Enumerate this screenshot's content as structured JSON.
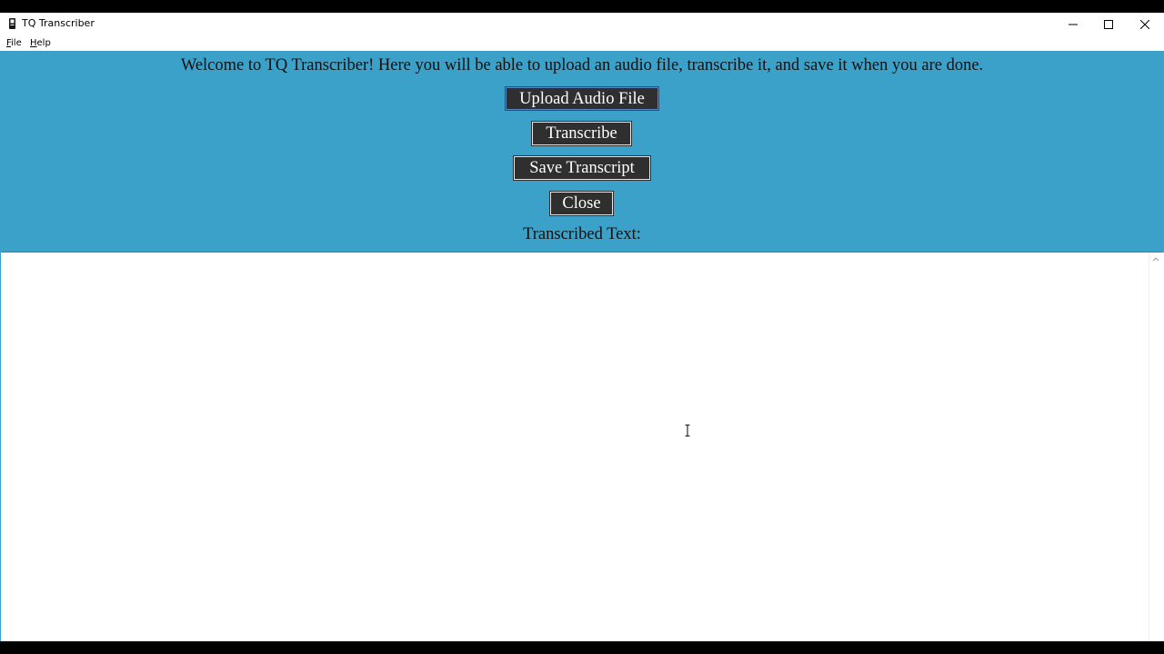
{
  "window": {
    "title": "TQ Transcriber",
    "icons": {
      "app": "app-icon",
      "minimize": "minimize-icon",
      "maximize": "maximize-icon",
      "close": "close-icon"
    }
  },
  "menubar": {
    "file_mnemonic": "F",
    "file_rest": "ile",
    "help_mnemonic": "H",
    "help_rest": "elp"
  },
  "panel": {
    "background_color": "#3ca1c9",
    "welcome_text": "Welcome to TQ Transcriber! Here you will be able to upload an audio file, transcribe it, and save it when you are done.",
    "buttons": {
      "upload": "Upload Audio File",
      "transcribe": "Transcribe",
      "save": "Save Transcript",
      "close": "Close"
    },
    "button_color": "#2f2f2f",
    "transcribed_label": "Transcribed Text:"
  },
  "transcript": {
    "value": ""
  }
}
